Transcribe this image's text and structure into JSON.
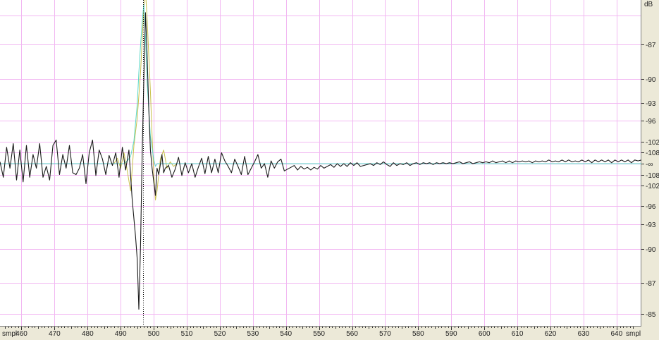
{
  "chart_data": {
    "type": "line",
    "x_unit_label": "smpl",
    "y_unit_label": "dB",
    "x_ticks": [
      460,
      470,
      480,
      490,
      500,
      510,
      520,
      530,
      540,
      550,
      560,
      570,
      580,
      590,
      600,
      610,
      620,
      630,
      640
    ],
    "xlim": [
      453.5,
      647.5
    ],
    "y_tick_labels": [
      "-87",
      "-90",
      "-93",
      "-96",
      "-102",
      "-108",
      "-∞",
      "-108",
      "-102",
      "-96",
      "-93",
      "-90",
      "-87",
      "-85"
    ],
    "cursor_x": 496.8,
    "colors": {
      "grid": "#f2b8f2",
      "black_trace": "#1a1a1a",
      "yellow_trace": "#c8c04a",
      "cyan_trace": "#5cd8c8",
      "cursor": "#000000"
    },
    "series": [
      {
        "color": "#1a1a1a",
        "points": [
          [
            453.5,
            0.2
          ],
          [
            454.5,
            -1.5
          ],
          [
            455.5,
            1.8
          ],
          [
            456.5,
            -0.5
          ],
          [
            457.5,
            2.2
          ],
          [
            458.5,
            -1.8
          ],
          [
            459.5,
            1.5
          ],
          [
            460.5,
            -2.0
          ],
          [
            461.5,
            2.0
          ],
          [
            462.5,
            -1.5
          ],
          [
            463.5,
            1.0
          ],
          [
            464.5,
            -0.5
          ],
          [
            465.5,
            2.2
          ],
          [
            466.5,
            -1.5
          ],
          [
            467.5,
            -0.3
          ],
          [
            468.5,
            -1.8
          ],
          [
            469.5,
            2.0
          ],
          [
            470.5,
            2.6
          ],
          [
            471.5,
            -1.2
          ],
          [
            472.5,
            1.0
          ],
          [
            473.5,
            -0.5
          ],
          [
            474.5,
            2.0
          ],
          [
            475.5,
            -1.0
          ],
          [
            476.5,
            -1.2
          ],
          [
            477.5,
            -0.5
          ],
          [
            478.5,
            1.0
          ],
          [
            479.5,
            -2.2
          ],
          [
            480.5,
            1.2
          ],
          [
            481.5,
            2.6
          ],
          [
            482.5,
            -1.3
          ],
          [
            483.5,
            1.5
          ],
          [
            484.5,
            0.5
          ],
          [
            485.5,
            -1.2
          ],
          [
            486.5,
            0.9
          ],
          [
            487.5,
            -0.2
          ],
          [
            488.5,
            1.2
          ],
          [
            489.5,
            -1.5
          ],
          [
            490.5,
            1.8
          ],
          [
            491.5,
            -0.7
          ],
          [
            492.5,
            1.5
          ],
          [
            493.5,
            -4.0
          ],
          [
            494.5,
            -8.0
          ],
          [
            495.0,
            -10.5
          ],
          [
            495.5,
            -16.0
          ],
          [
            496.0,
            -9.0
          ],
          [
            496.5,
            1.0
          ],
          [
            497.0,
            9.0
          ],
          [
            497.5,
            16.6
          ],
          [
            498.0,
            12.0
          ],
          [
            498.5,
            6.0
          ],
          [
            499.0,
            1.5
          ],
          [
            499.5,
            -0.5
          ],
          [
            500.5,
            -3.5
          ],
          [
            501.0,
            -0.5
          ],
          [
            501.5,
            -1.2
          ],
          [
            502.5,
            1.0
          ],
          [
            503.0,
            -1.0
          ],
          [
            503.5,
            -0.5
          ],
          [
            504.5,
            -0.2
          ],
          [
            505.5,
            -1.5
          ],
          [
            506.5,
            -0.6
          ],
          [
            507.5,
            0.7
          ],
          [
            508.5,
            -1.3
          ],
          [
            509.5,
            0.1
          ],
          [
            510.5,
            -1.0
          ],
          [
            511.5,
            0.0
          ],
          [
            512.5,
            -1.5
          ],
          [
            513.5,
            -0.4
          ],
          [
            514.5,
            0.6
          ],
          [
            515.5,
            -1.1
          ],
          [
            516.5,
            0.8
          ],
          [
            517.5,
            -1.0
          ],
          [
            518.5,
            0.5
          ],
          [
            519.5,
            -1.0
          ],
          [
            520.5,
            1.2
          ],
          [
            521.5,
            0.3
          ],
          [
            522.5,
            -0.3
          ],
          [
            523.5,
            -1.0
          ],
          [
            524.5,
            0.5
          ],
          [
            525.5,
            -0.3
          ],
          [
            526.5,
            -1.2
          ],
          [
            527.5,
            0.8
          ],
          [
            528.5,
            -1.2
          ],
          [
            529.5,
            -0.5
          ],
          [
            530.5,
            0.2
          ],
          [
            531.5,
            1.0
          ],
          [
            532.5,
            -0.5
          ],
          [
            533.5,
            0.0
          ],
          [
            534.5,
            -1.5
          ],
          [
            535.5,
            0.3
          ],
          [
            536.5,
            -0.5
          ],
          [
            537.5,
            0.2
          ],
          [
            538.5,
            0.5
          ],
          [
            539.5,
            -0.8
          ],
          [
            540.5,
            -0.6
          ],
          [
            541.5,
            -0.4
          ],
          [
            542.5,
            -0.2
          ],
          [
            543.5,
            -0.7
          ],
          [
            544.5,
            -0.3
          ],
          [
            545.5,
            -0.6
          ],
          [
            546.5,
            -0.4
          ],
          [
            547.5,
            -0.7
          ],
          [
            548.5,
            -0.4
          ],
          [
            549.5,
            -0.6
          ],
          [
            550.5,
            -0.2
          ],
          [
            551.5,
            -0.5
          ],
          [
            552.5,
            -0.3
          ],
          [
            553.5,
            -0.1
          ],
          [
            554.5,
            -0.4
          ],
          [
            555.5,
            0.0
          ],
          [
            556.5,
            -0.3
          ],
          [
            557.5,
            0.0
          ],
          [
            558.5,
            -0.3
          ],
          [
            559.5,
            0.1
          ],
          [
            560.5,
            -0.2
          ],
          [
            561.5,
            0.1
          ],
          [
            562.5,
            -0.3
          ],
          [
            563.5,
            -0.2
          ],
          [
            564.5,
            -0.1
          ],
          [
            565.5,
            0.0
          ],
          [
            566.5,
            -0.2
          ],
          [
            567.5,
            0.1
          ],
          [
            568.5,
            -0.1
          ],
          [
            569.5,
            0.2
          ],
          [
            570.5,
            -0.1
          ],
          [
            571.5,
            -0.3
          ],
          [
            572.5,
            0.1
          ],
          [
            573.5,
            -0.2
          ],
          [
            574.5,
            0.0
          ],
          [
            575.5,
            -0.1
          ],
          [
            576.5,
            0.1
          ],
          [
            577.5,
            -0.2
          ],
          [
            578.5,
            0.0
          ],
          [
            579.5,
            0.1
          ],
          [
            580.5,
            -0.1
          ],
          [
            581.5,
            0.1
          ],
          [
            582.5,
            0.0
          ],
          [
            583.5,
            0.1
          ],
          [
            584.5,
            -0.1
          ],
          [
            585.5,
            0.1
          ],
          [
            586.5,
            0.0
          ],
          [
            587.5,
            0.1
          ],
          [
            588.5,
            0.0
          ],
          [
            589.5,
            0.1
          ],
          [
            590.5,
            0.0
          ],
          [
            591.5,
            0.1
          ],
          [
            592.5,
            0.2
          ],
          [
            593.5,
            0.0
          ],
          [
            594.5,
            0.1
          ],
          [
            595.5,
            0.2
          ],
          [
            596.5,
            0.0
          ],
          [
            597.5,
            0.1
          ],
          [
            598.5,
            0.2
          ],
          [
            599.5,
            0.1
          ],
          [
            600.5,
            0.2
          ],
          [
            601.5,
            0.1
          ],
          [
            602.5,
            0.3
          ],
          [
            603.5,
            0.1
          ],
          [
            604.5,
            0.2
          ],
          [
            605.5,
            0.3
          ],
          [
            606.5,
            0.1
          ],
          [
            607.5,
            0.3
          ],
          [
            608.5,
            0.1
          ],
          [
            609.5,
            0.3
          ],
          [
            610.5,
            0.2
          ],
          [
            611.5,
            0.3
          ],
          [
            612.5,
            0.2
          ],
          [
            613.5,
            0.3
          ],
          [
            614.5,
            0.1
          ],
          [
            615.5,
            0.3
          ],
          [
            616.5,
            0.2
          ],
          [
            617.5,
            0.3
          ],
          [
            618.5,
            0.2
          ],
          [
            619.5,
            0.4
          ],
          [
            620.5,
            0.2
          ],
          [
            621.5,
            0.3
          ],
          [
            622.5,
            0.2
          ],
          [
            623.5,
            0.4
          ],
          [
            624.5,
            0.2
          ],
          [
            625.5,
            0.4
          ],
          [
            626.5,
            0.2
          ],
          [
            627.5,
            0.3
          ],
          [
            628.5,
            0.2
          ],
          [
            629.5,
            0.4
          ],
          [
            630.5,
            0.2
          ],
          [
            631.5,
            0.4
          ],
          [
            632.5,
            0.1
          ],
          [
            633.5,
            0.4
          ],
          [
            634.5,
            0.2
          ],
          [
            635.5,
            0.4
          ],
          [
            636.5,
            0.2
          ],
          [
            637.5,
            0.4
          ],
          [
            638.5,
            0.1
          ],
          [
            639.5,
            0.4
          ],
          [
            640.5,
            0.2
          ],
          [
            641.5,
            0.4
          ],
          [
            642.5,
            0.2
          ],
          [
            643.5,
            0.4
          ],
          [
            644.5,
            0.1
          ],
          [
            645.5,
            0.4
          ],
          [
            646.5,
            0.3
          ],
          [
            647.5,
            0.4
          ]
        ]
      },
      {
        "color": "#c8c04a",
        "points": [
          [
            453.5,
            0.0
          ],
          [
            488.0,
            0.0
          ],
          [
            489.0,
            0.6
          ],
          [
            490.0,
            -0.5
          ],
          [
            491.0,
            1.2
          ],
          [
            492.0,
            -0.8
          ],
          [
            493.0,
            -3.0
          ],
          [
            494.0,
            2.0
          ],
          [
            495.0,
            5.0
          ],
          [
            496.0,
            10.0
          ],
          [
            496.5,
            13.5
          ],
          [
            497.0,
            17.0
          ],
          [
            497.5,
            19.0
          ],
          [
            498.0,
            16.0
          ],
          [
            499.0,
            8.0
          ],
          [
            499.5,
            3.0
          ],
          [
            500.0,
            -1.0
          ],
          [
            500.5,
            -4.0
          ],
          [
            501.0,
            -3.0
          ],
          [
            502.0,
            0.5
          ],
          [
            503.0,
            1.5
          ],
          [
            504.0,
            -0.5
          ],
          [
            505.0,
            0.2
          ],
          [
            506.0,
            -0.3
          ],
          [
            507.0,
            0.0
          ],
          [
            647.5,
            0.0
          ]
        ]
      },
      {
        "color": "#5cd8c8",
        "points": [
          [
            453.5,
            0.0
          ],
          [
            491.0,
            0.0
          ],
          [
            492.0,
            0.3
          ],
          [
            493.0,
            0.8
          ],
          [
            494.0,
            2.5
          ],
          [
            495.0,
            6.5
          ],
          [
            495.5,
            10.0
          ],
          [
            496.0,
            13.0
          ],
          [
            496.5,
            15.5
          ],
          [
            497.0,
            17.5
          ],
          [
            497.5,
            14.0
          ],
          [
            498.0,
            9.0
          ],
          [
            499.0,
            3.0
          ],
          [
            500.0,
            0.5
          ],
          [
            500.5,
            -0.3
          ],
          [
            501.0,
            0.0
          ],
          [
            647.5,
            0.0
          ]
        ]
      }
    ]
  }
}
